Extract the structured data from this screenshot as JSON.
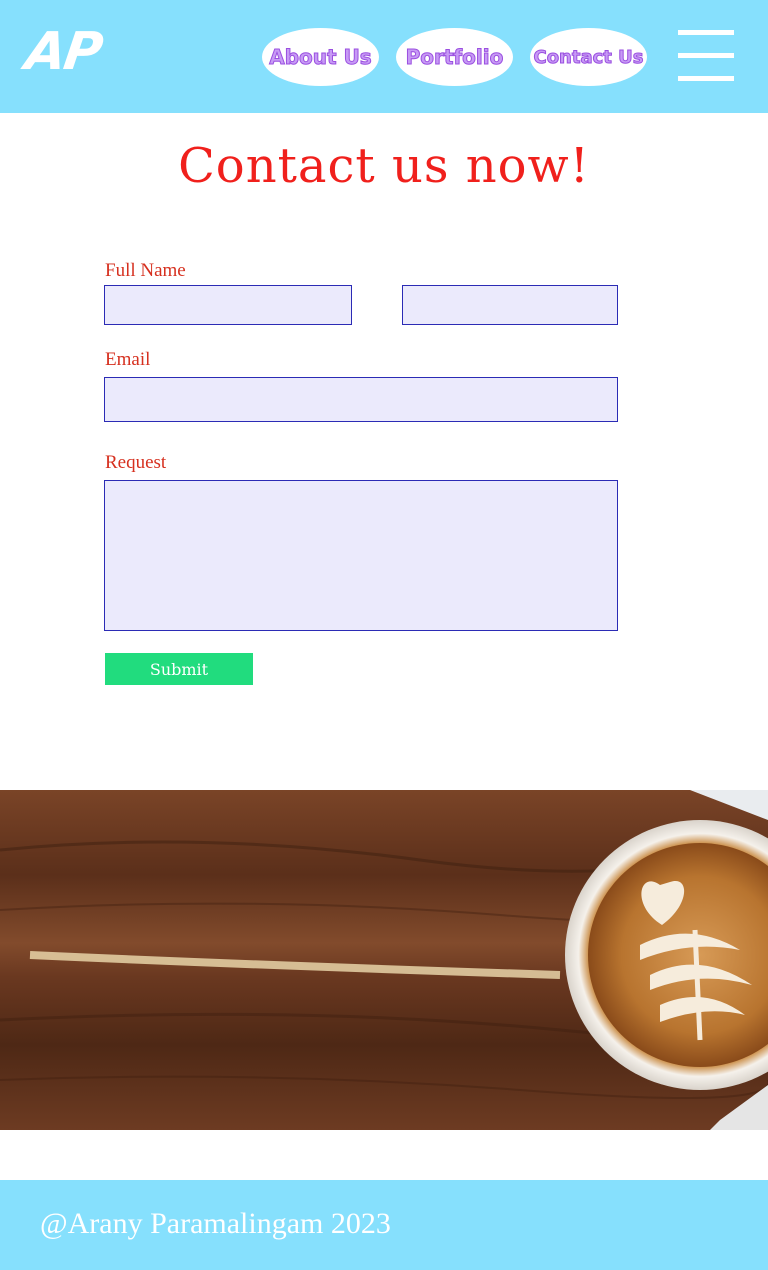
{
  "header": {
    "logo": "AP",
    "nav": [
      "About Us",
      "Portfolio",
      "Contact Us"
    ],
    "menu_icon": "hamburger-menu-icon",
    "background_color": "#86e0fd"
  },
  "main": {
    "title": "Contact us now!",
    "form": {
      "full_name_label": "Full Name",
      "first_name_value": "",
      "last_name_value": "",
      "email_label": "Email",
      "email_value": "",
      "request_label": "Request",
      "request_value": "",
      "submit_label": "Submit"
    }
  },
  "image": {
    "description_icon": "coffee-on-wooden-table-photo"
  },
  "footer": {
    "text": "@Arany Paramalingam 2023"
  },
  "colors": {
    "accent": "#f0201c",
    "submit": "#21dc7e",
    "field_bg": "#ebeafc",
    "field_border": "#2b2bb5",
    "nav_text": "#c79af5"
  }
}
